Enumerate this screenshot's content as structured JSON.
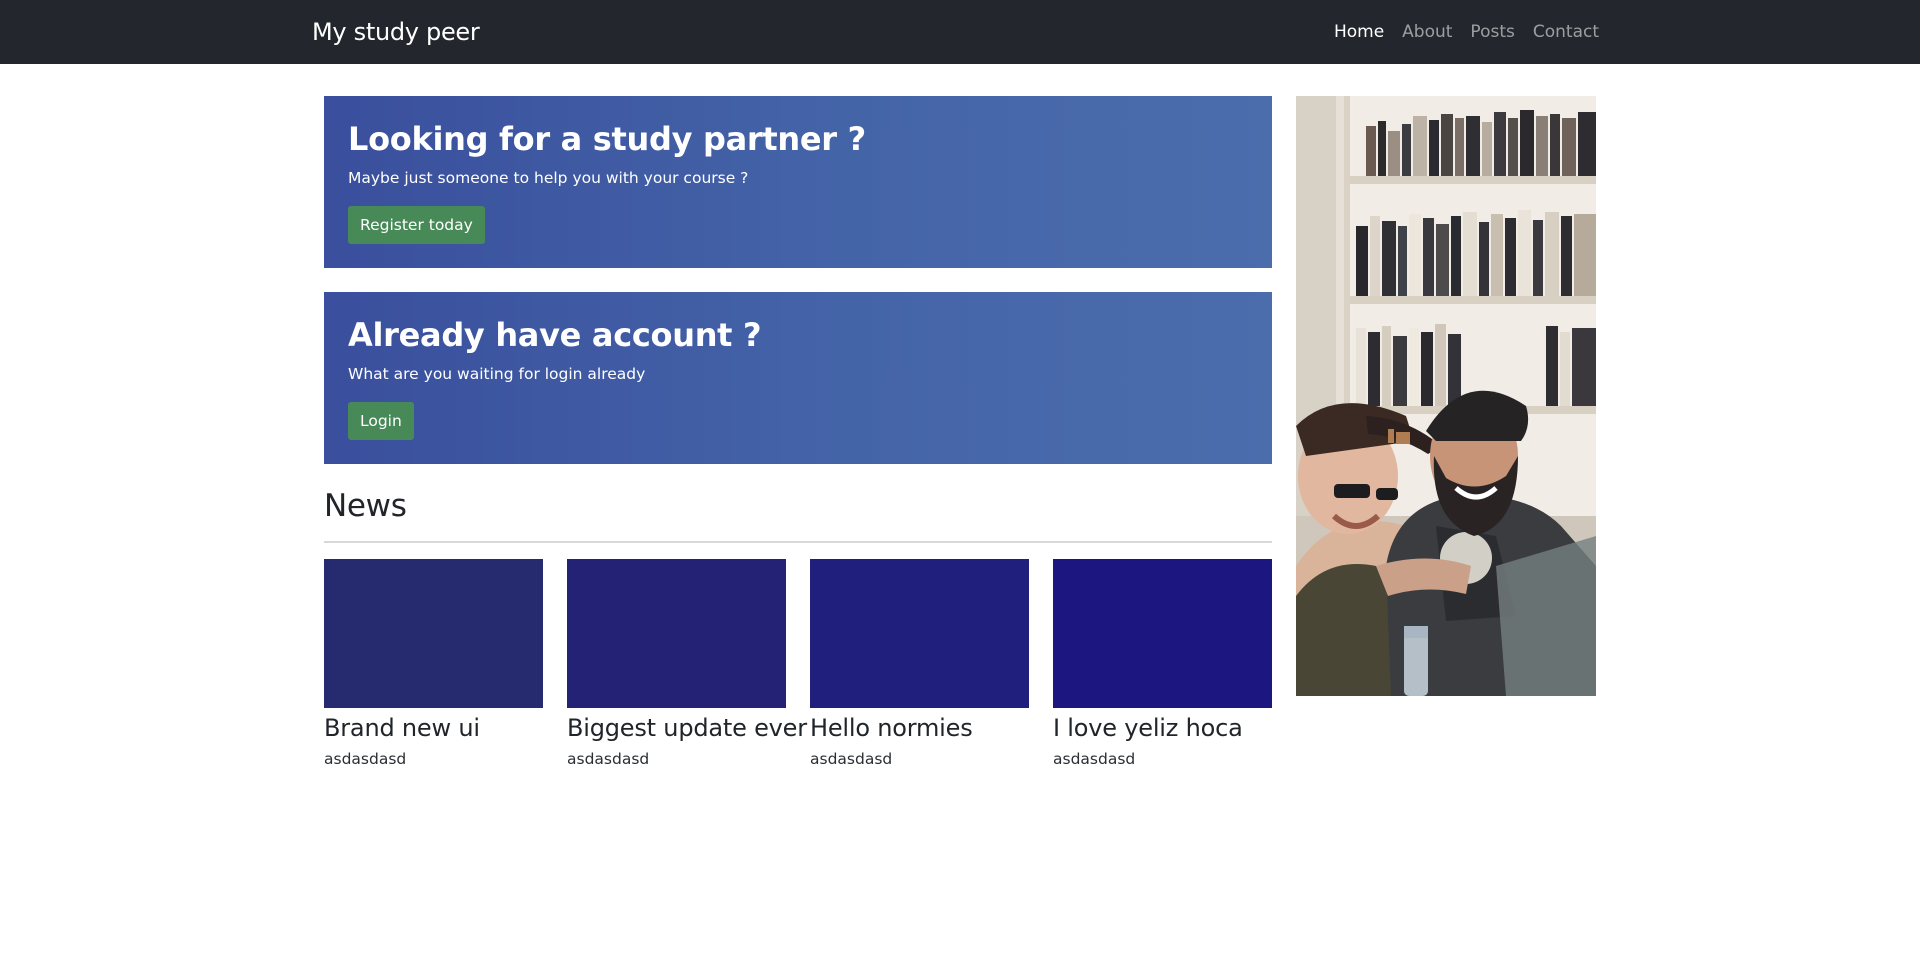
{
  "navbar": {
    "brand": "My study peer",
    "links": [
      {
        "label": "Home",
        "active": true
      },
      {
        "label": "About",
        "active": false
      },
      {
        "label": "Posts",
        "active": false
      },
      {
        "label": "Contact",
        "active": false
      }
    ]
  },
  "hero": [
    {
      "title": "Looking for a study partner ?",
      "subtitle": "Maybe just someone to help you with your course ?",
      "button": "Register today"
    },
    {
      "title": "Already have account ?",
      "subtitle": "What are you waiting for login already",
      "button": "Login"
    }
  ],
  "news": {
    "heading": "News",
    "items": [
      {
        "title": "Brand new ui",
        "text": "asdasdasd",
        "color": "#262a6f"
      },
      {
        "title": "Biggest update ever",
        "text": "asdasdasd",
        "color": "#232275"
      },
      {
        "title": "Hello normies",
        "text": "asdasdasd",
        "color": "#201f7e"
      },
      {
        "title": "I love yeliz hoca",
        "text": "asdasdasd",
        "color": "#1b1680"
      }
    ]
  },
  "colors": {
    "navbar": "#23262c",
    "panel": "#4464a8",
    "button": "#478a58"
  }
}
